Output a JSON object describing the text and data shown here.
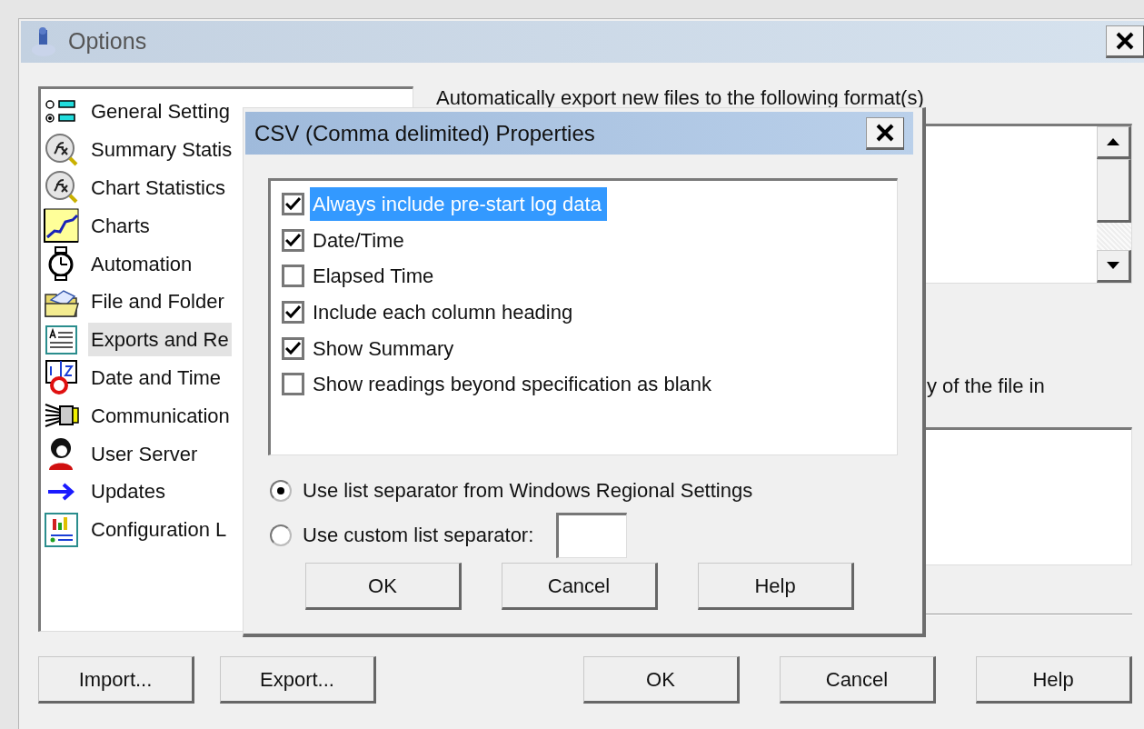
{
  "window": {
    "title": "Options"
  },
  "sidebar": {
    "items": [
      {
        "label": "General Setting",
        "kind": "settings",
        "selected": false
      },
      {
        "label": "Summary Statis",
        "kind": "statistics",
        "selected": false
      },
      {
        "label": "Chart Statistics",
        "kind": "statistics",
        "selected": false
      },
      {
        "label": "Charts",
        "kind": "chart",
        "selected": false
      },
      {
        "label": "Automation",
        "kind": "stopwatch",
        "selected": false
      },
      {
        "label": "File and Folder",
        "kind": "folder",
        "selected": false
      },
      {
        "label": "Exports and Re",
        "kind": "report",
        "selected": true
      },
      {
        "label": "Date and Time",
        "kind": "calendar",
        "selected": false
      },
      {
        "label": "Communication",
        "kind": "connector",
        "selected": false
      },
      {
        "label": "User Server",
        "kind": "user",
        "selected": false
      },
      {
        "label": "Updates",
        "kind": "arrow",
        "selected": false
      },
      {
        "label": "Configuration L",
        "kind": "config",
        "selected": false
      }
    ]
  },
  "export_formats": {
    "label": "Automatically export new files to the following format(s)"
  },
  "note": {
    "label": "y of the file in"
  },
  "buttons": {
    "left": [
      "Import...",
      "Export..."
    ],
    "right": [
      "OK",
      "Cancel",
      "Help"
    ]
  },
  "dialog": {
    "title": "CSV (Comma delimited) Properties",
    "options": [
      {
        "label": "Always include pre-start log data",
        "checked": true,
        "selected": true
      },
      {
        "label": "Date/Time",
        "checked": true,
        "selected": false
      },
      {
        "label": "Elapsed Time",
        "checked": false,
        "selected": false
      },
      {
        "label": "Include each column heading",
        "checked": true,
        "selected": false
      },
      {
        "label": "Show Summary",
        "checked": true,
        "selected": false
      },
      {
        "label": "Show readings beyond specification as blank",
        "checked": false,
        "selected": false
      }
    ],
    "separator": [
      {
        "label": "Use list separator from Windows Regional Settings",
        "kind": "plain",
        "selected": true
      },
      {
        "label": "Use custom list separator:",
        "kind": "field",
        "selected": false
      }
    ],
    "buttons": [
      "OK",
      "Cancel",
      "Help"
    ]
  }
}
